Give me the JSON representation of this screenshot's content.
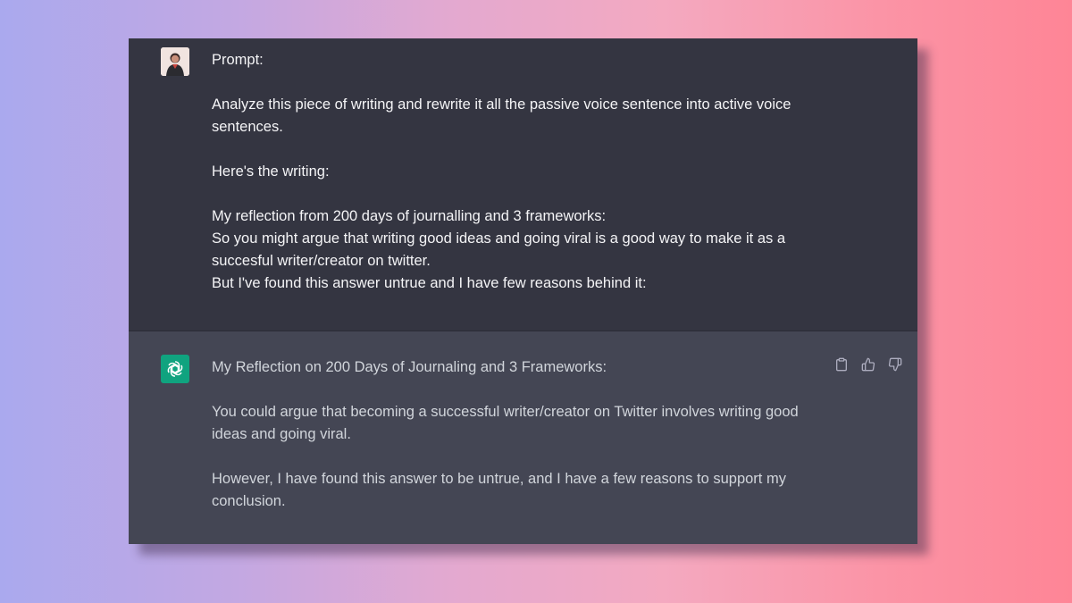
{
  "conversation": {
    "user": {
      "avatar_icon": "user-avatar-icon",
      "paragraphs": [
        "Prompt:",
        "Analyze this piece of writing and rewrite it all the passive voice sentence into active voice sentences.",
        "Here's the writing:",
        "My reflection from 200 days of journalling and 3 frameworks:\nSo you might argue that writing good ideas and going viral is a good way to make it as a succesful writer/creator on twitter.\nBut I've found this answer untrue and I have few reasons behind it:"
      ]
    },
    "assistant": {
      "avatar_icon": "chatgpt-logo-icon",
      "paragraphs": [
        "My Reflection on 200 Days of Journaling and 3 Frameworks:",
        "You could argue that becoming a successful writer/creator on Twitter involves writing good ideas and going viral.",
        "However, I have found this answer to be untrue, and I have a few reasons to support my conclusion."
      ],
      "actions": [
        "clipboard-icon",
        "thumbs-up-icon",
        "thumbs-down-icon"
      ]
    }
  },
  "colors": {
    "user_bg": "#343541",
    "assistant_bg": "#444654",
    "brand": "#10a37f"
  }
}
